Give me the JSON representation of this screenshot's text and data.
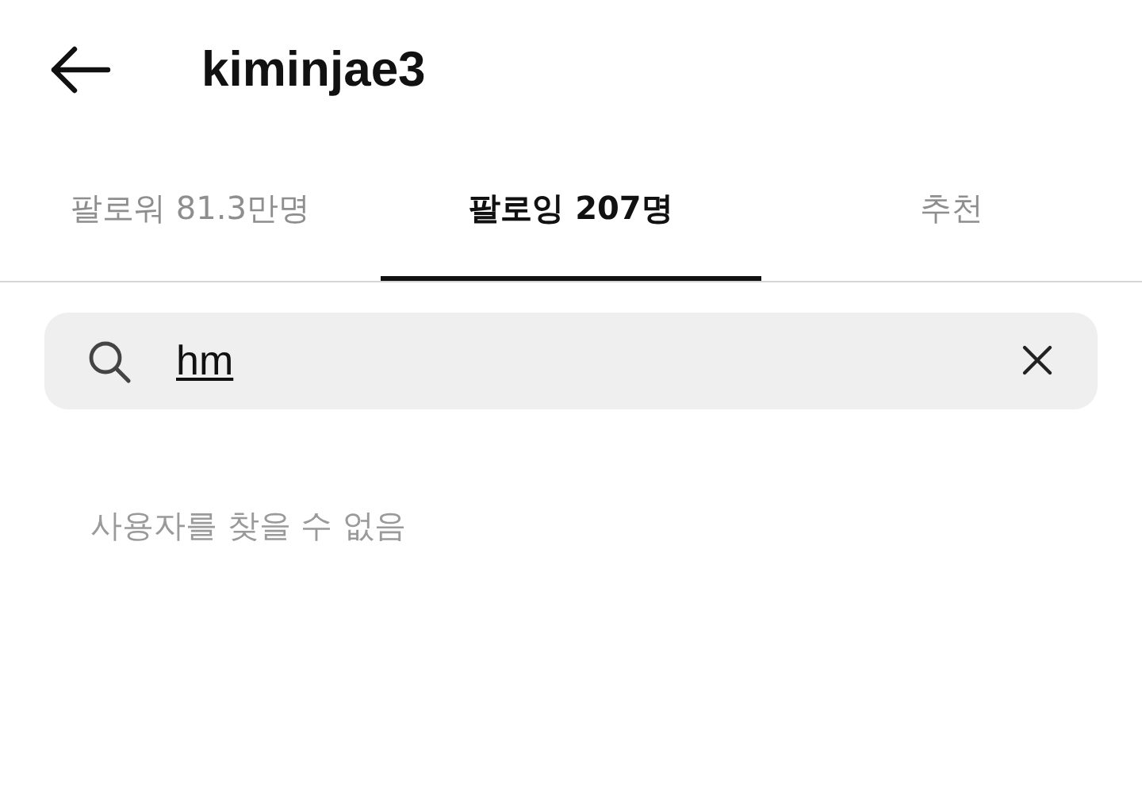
{
  "header": {
    "title": "kiminjae3"
  },
  "tabs": [
    {
      "label": "팔로워 81.3만명",
      "selected": false
    },
    {
      "label": "팔로잉 207명",
      "selected": true
    },
    {
      "label": "추천",
      "selected": false
    }
  ],
  "search": {
    "value": "hm",
    "composing": true
  },
  "empty_message": "사용자를 찾을 수 없음"
}
